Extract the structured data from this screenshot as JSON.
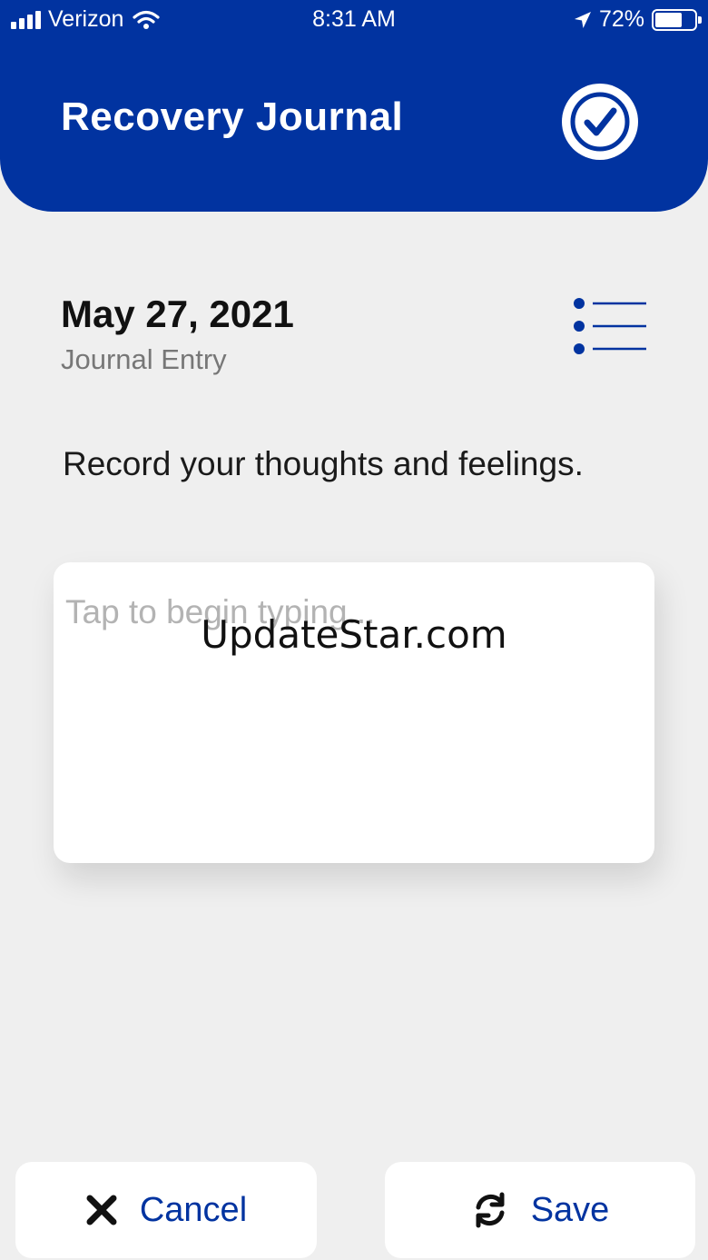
{
  "status_bar": {
    "carrier": "Verizon",
    "time": "8:31 AM",
    "battery_percent": "72%",
    "battery_level": 0.72,
    "icons": [
      "signal-icon",
      "wifi-icon",
      "location-arrow-icon",
      "battery-icon"
    ]
  },
  "header": {
    "title": "Recovery Journal",
    "action_icon": "check-circle-icon"
  },
  "entry": {
    "date": "May 27, 2021",
    "subtitle": "Journal Entry",
    "list_icon": "list-icon",
    "prompt": "Record your thoughts and feelings.",
    "placeholder": "Tap to begin typing...",
    "value": ""
  },
  "watermark": "UpdateStar.com",
  "footer": {
    "cancel_label": "Cancel",
    "cancel_icon": "close-icon",
    "save_label": "Save",
    "save_icon": "sync-icon"
  },
  "colors": {
    "brand_blue": "#0133a0",
    "background": "#efefef",
    "card": "#ffffff",
    "placeholder_gray": "#b3b3b3"
  }
}
